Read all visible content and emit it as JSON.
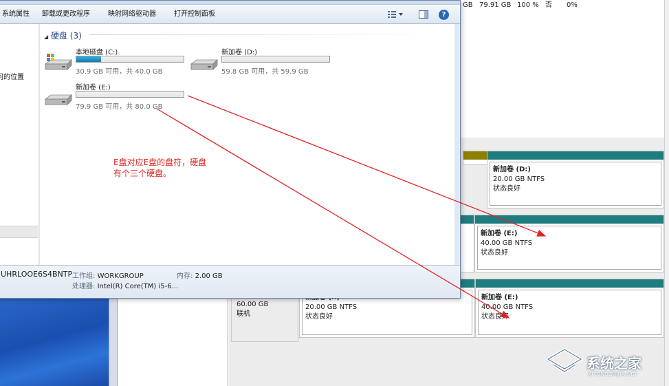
{
  "disk_mgmt": {
    "top_row": [
      "GB",
      "79.91 GB",
      "100 %",
      "否",
      "0%"
    ],
    "disk3_label": {
      "size": "60.00 GB",
      "status": "联机"
    },
    "volumes": [
      {
        "name": "新加卷 (D:)",
        "size": "20.00 GB NTFS",
        "status": "状态良好"
      },
      {
        "name": "新加卷 (E:)",
        "size": "40.00 GB NTFS",
        "status": "状态良好"
      },
      {
        "name": "新加卷 (I:)",
        "size": "20.00 GB NTFS",
        "status": "状态良好"
      },
      {
        "name": "新加卷 (E:)",
        "size": "40.00 GB NTFS",
        "status": "状态良好"
      }
    ]
  },
  "explorer": {
    "toolbar": {
      "system_properties": "系统属性",
      "uninstall": "卸载或更改程序",
      "map_drive": "映射网络驱动器",
      "control_panel": "打开控制面板",
      "views_icon": "view-list-icon",
      "preview_icon": "preview-pane-icon",
      "help": "?"
    },
    "nav": {
      "location_text": "问的位置"
    },
    "group": {
      "arrow": "◢",
      "title": "硬盘 (3)"
    },
    "drives": [
      {
        "name": "本地磁盘 (C:)",
        "info": "30.9 GB 可用，共 40.0 GB",
        "used_fraction": 0.23,
        "icon": "os-drive-icon"
      },
      {
        "name": "新加卷 (D:)",
        "info": "59.8 GB 可用，共 59.9 GB",
        "used_fraction": 0.0,
        "icon": "hard-drive-icon"
      },
      {
        "name": "新加卷 (E:)",
        "info": "79.9 GB 可用，共 80.0 GB",
        "used_fraction": 0.0,
        "icon": "hard-drive-icon"
      }
    ],
    "annotation": {
      "line1": "E盘对应E盘的盘符，硬盘",
      "line2": "有个三个硬盘。"
    },
    "details": {
      "computer_name": "UHRLOOE6S4BNTP",
      "workgroup_label": "工作组:",
      "workgroup": "WORKGROUP",
      "memory_label": "内存:",
      "memory": "2.00 GB",
      "cpu_label": "处理器:",
      "cpu": "Intel(R) Core(TM) i5-6..."
    }
  },
  "colors": {
    "volume_bar": "#1f7d80",
    "volume_bar_olive": "#8b8000",
    "annotation": "#e02424",
    "drive_fill": "#1579b5"
  },
  "watermark": {
    "text": "系统之家",
    "sub": "XITONGZHIJIA.NET"
  }
}
